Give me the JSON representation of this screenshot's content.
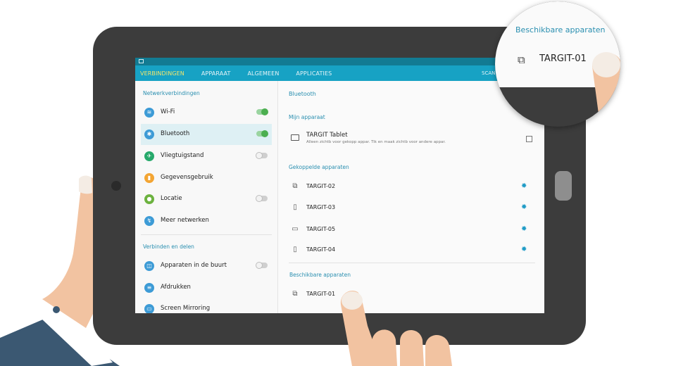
{
  "tabs": [
    {
      "label": "VERBINDINGEN",
      "active": true
    },
    {
      "label": "APPARAAT",
      "active": false
    },
    {
      "label": "ALGEMEEN",
      "active": false
    },
    {
      "label": "APPLICATIES",
      "active": false
    }
  ],
  "scan_label": "SCAN",
  "left": {
    "section1": "Netwerkverbindingen",
    "items1": [
      {
        "label": "Wi-Fi",
        "toggle": "on",
        "color": "#3d9bd6",
        "icon": "wifi-icon"
      },
      {
        "label": "Bluetooth",
        "toggle": "on",
        "color": "#3d9bd6",
        "icon": "bluetooth-icon"
      },
      {
        "label": "Vliegtuigstand",
        "toggle": "off",
        "color": "#27a96b",
        "icon": "airplane-icon"
      },
      {
        "label": "Gegevensgebruik",
        "toggle": null,
        "color": "#f3a533",
        "icon": "data-usage-icon"
      },
      {
        "label": "Locatie",
        "toggle": "off",
        "color": "#6cb23f",
        "icon": "location-icon"
      },
      {
        "label": "Meer netwerken",
        "toggle": null,
        "color": "#3d9bd6",
        "icon": "more-networks-icon"
      }
    ],
    "section2": "Verbinden en delen",
    "items2": [
      {
        "label": "Apparaten in de buurt",
        "toggle": "off",
        "color": "#3d9bd6",
        "icon": "nearby-devices-icon"
      },
      {
        "label": "Afdrukken",
        "toggle": null,
        "color": "#3d9bd6",
        "icon": "printer-icon"
      },
      {
        "label": "Screen Mirroring",
        "toggle": null,
        "color": "#3d9bd6",
        "icon": "screen-mirroring-icon"
      }
    ]
  },
  "right": {
    "title": "Bluetooth",
    "my_device_head": "Mijn apparaat",
    "my_device_name": "TARGIT Tablet",
    "my_device_sub": "Alleen zichtb voor gekopp appar. Tik en maak zichtb voor andere appar.",
    "paired_head": "Gekoppelde apparaten",
    "paired": [
      {
        "name": "TARGIT-02",
        "icon": "multi-device-icon"
      },
      {
        "name": "TARGIT-03",
        "icon": "phone-icon"
      },
      {
        "name": "TARGIT-05",
        "icon": "laptop-icon"
      },
      {
        "name": "TARGIT-04",
        "icon": "phone-icon"
      }
    ],
    "available_head": "Beschikbare apparaten",
    "available": [
      {
        "name": "TARGIT-01",
        "icon": "multi-device-icon"
      }
    ]
  },
  "magnifier": {
    "head": "Beschikbare apparaten",
    "name": "TARGIT-01"
  }
}
